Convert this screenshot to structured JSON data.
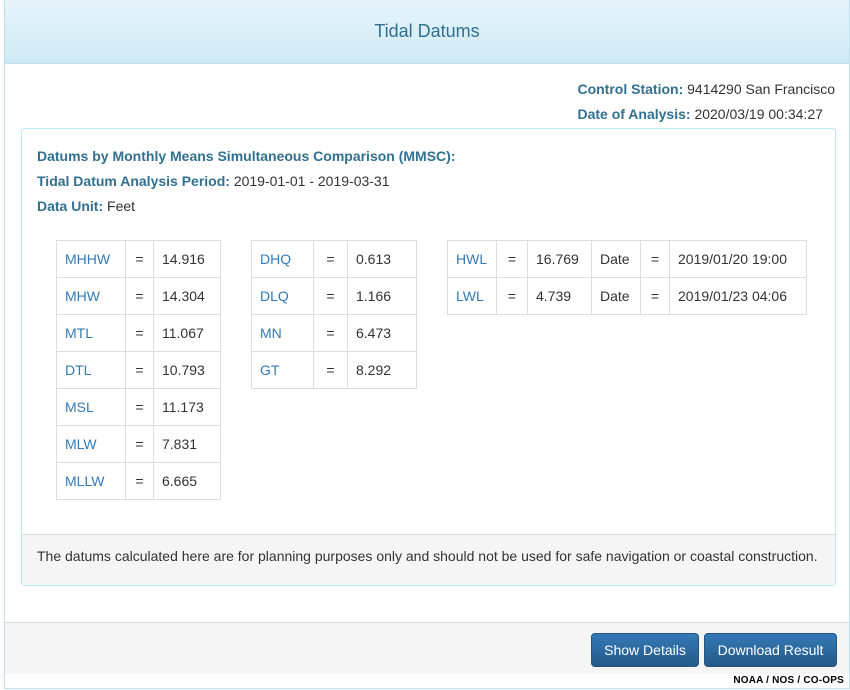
{
  "dialog": {
    "title": "Tidal Datums"
  },
  "station": {
    "control_label": "Control Station:",
    "control_value": "9414290 San Francisco",
    "date_label": "Date of Analysis:",
    "date_value": "2020/03/19 00:34:27"
  },
  "analysis": {
    "method_label": "Datums by Monthly Means Simultaneous Comparison (MMSC):",
    "period_label": "Tidal Datum Analysis Period:",
    "period_value": "2019-01-01 - 2019-03-31",
    "unit_label": "Data Unit:",
    "unit_value": "Feet"
  },
  "datums_main": [
    {
      "name": "MHHW",
      "eq": "=",
      "value": "14.916"
    },
    {
      "name": "MHW",
      "eq": "=",
      "value": "14.304"
    },
    {
      "name": "MTL",
      "eq": "=",
      "value": "11.067"
    },
    {
      "name": "DTL",
      "eq": "=",
      "value": "10.793"
    },
    {
      "name": "MSL",
      "eq": "=",
      "value": "11.173"
    },
    {
      "name": "MLW",
      "eq": "=",
      "value": "7.831"
    },
    {
      "name": "MLLW",
      "eq": "=",
      "value": "6.665"
    }
  ],
  "datums_ranges": [
    {
      "name": "DHQ",
      "eq": "=",
      "value": "0.613"
    },
    {
      "name": "DLQ",
      "eq": "=",
      "value": "1.166"
    },
    {
      "name": "MN",
      "eq": "=",
      "value": "6.473"
    },
    {
      "name": "GT",
      "eq": "=",
      "value": "8.292"
    }
  ],
  "extremes": [
    {
      "name": "HWL",
      "eq": "=",
      "value": "16.769",
      "date_label": "Date",
      "eq2": "=",
      "date": "2019/01/20 19:00"
    },
    {
      "name": "LWL",
      "eq": "=",
      "value": "4.739",
      "date_label": "Date",
      "eq2": "=",
      "date": "2019/01/23 04:06"
    }
  ],
  "disclaimer": "The datums calculated here are for planning purposes only and should not be used for safe navigation or coastal construction.",
  "buttons": {
    "details": "Show Details",
    "download": "Download Result"
  },
  "credit": "NOAA / NOS / CO-OPS"
}
